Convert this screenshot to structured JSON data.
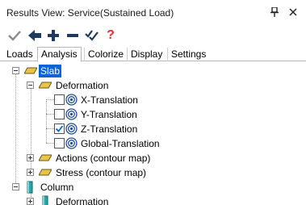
{
  "window": {
    "title": "Results View: Service(Sustained Load)",
    "pin_icon": "pin-icon",
    "close_icon": "close-icon"
  },
  "toolbar": {
    "buttons": [
      {
        "name": "apply-check-icon",
        "color": "#8a8a8a"
      },
      {
        "name": "back-arrow-icon",
        "color": "#1f3a5f"
      },
      {
        "name": "add-plus-icon",
        "color": "#1f3a5f"
      },
      {
        "name": "remove-minus-icon",
        "color": "#1f3a5f"
      },
      {
        "name": "multi-check-icon",
        "color": "#1f3a5f"
      },
      {
        "name": "help-icon",
        "color": "#e03030"
      }
    ]
  },
  "tabs": [
    {
      "label": "Loads",
      "active": false
    },
    {
      "label": "Analysis",
      "active": true
    },
    {
      "label": "Colorize",
      "active": false
    },
    {
      "label": "Display",
      "active": false
    },
    {
      "label": "Settings",
      "active": false
    }
  ],
  "tree": {
    "slab": {
      "label": "Slab",
      "selected": true,
      "expanded": true
    },
    "deformation": {
      "label": "Deformation",
      "expanded": true
    },
    "items": [
      {
        "label": "X-Translation",
        "checked": false
      },
      {
        "label": "Y-Translation",
        "checked": false
      },
      {
        "label": "Z-Translation",
        "checked": true
      },
      {
        "label": "Global-Translation",
        "checked": false
      }
    ],
    "actions": {
      "label": "Actions (contour map)",
      "expanded": false
    },
    "stress": {
      "label": "Stress (contour map)",
      "expanded": false
    },
    "column": {
      "label": "Column",
      "expanded": true
    },
    "column_deformation": {
      "label": "Deformation",
      "expanded": false
    }
  },
  "colors": {
    "selection": "#0a64d6",
    "folder_yellow": "#e8c54a",
    "column_teal": "#2aa6a6",
    "radio_blue": "#1f4e9c"
  }
}
